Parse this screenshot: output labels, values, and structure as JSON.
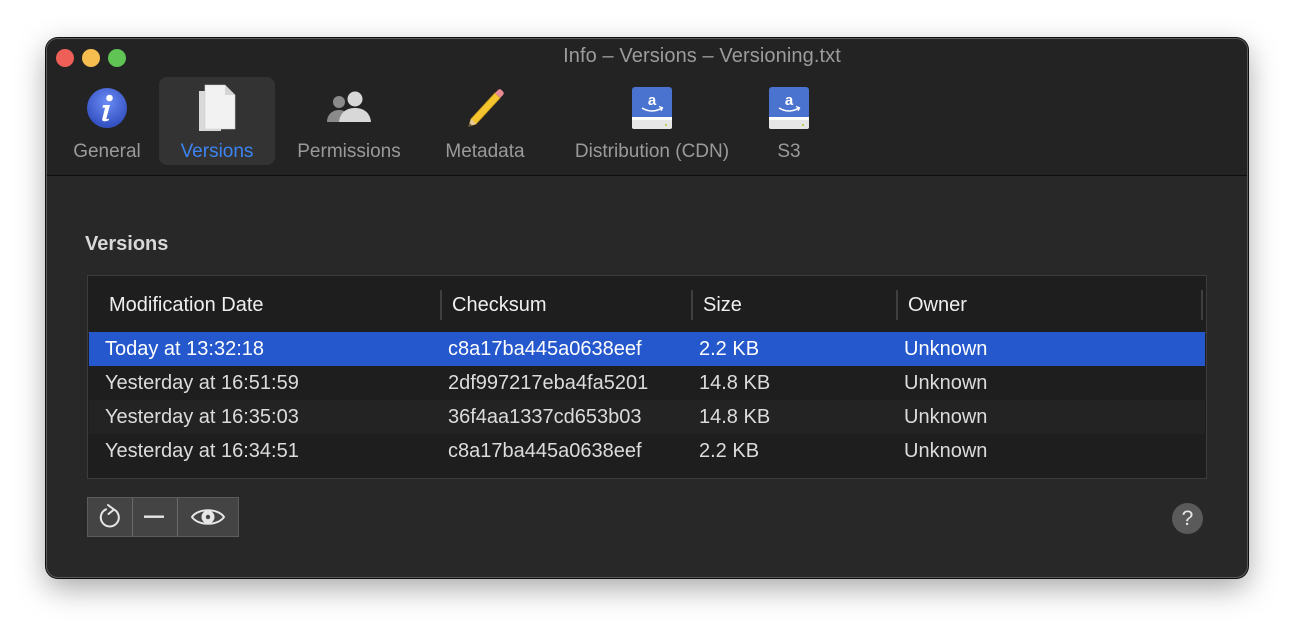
{
  "window": {
    "title": "Info – Versions – Versioning.txt"
  },
  "toolbar": {
    "tabs": [
      {
        "label": "General",
        "icon": "info-icon",
        "active": false
      },
      {
        "label": "Versions",
        "icon": "documents-icon",
        "active": true
      },
      {
        "label": "Permissions",
        "icon": "people-icon",
        "active": false
      },
      {
        "label": "Metadata",
        "icon": "pencil-icon",
        "active": false
      },
      {
        "label": "Distribution (CDN)",
        "icon": "amazon-drive-icon",
        "active": false
      },
      {
        "label": "S3",
        "icon": "amazon-drive-icon",
        "active": false
      }
    ]
  },
  "versions": {
    "section_title": "Versions",
    "columns": [
      "Modification Date",
      "Checksum",
      "Size",
      "Owner"
    ],
    "rows": [
      {
        "date": "Today at 13:32:18",
        "checksum": "c8a17ba445a0638eef",
        "size": "2.2 KB",
        "owner": "Unknown",
        "selected": true
      },
      {
        "date": "Yesterday at 16:51:59",
        "checksum": "2df997217eba4fa5201",
        "size": "14.8 KB",
        "owner": "Unknown",
        "selected": false
      },
      {
        "date": "Yesterday at 16:35:03",
        "checksum": "36f4aa1337cd653b03",
        "size": "14.8 KB",
        "owner": "Unknown",
        "selected": false
      },
      {
        "date": "Yesterday at 16:34:51",
        "checksum": "c8a17ba445a0638eef",
        "size": "2.2 KB",
        "owner": "Unknown",
        "selected": false
      }
    ]
  },
  "actions": {
    "buttons": [
      {
        "name": "revert",
        "icon": "revert-arrow-icon"
      },
      {
        "name": "delete",
        "icon": "minus-icon"
      },
      {
        "name": "quicklook",
        "icon": "eye-icon"
      }
    ],
    "help_label": "?"
  },
  "colors": {
    "accent": "#3d84f2",
    "selection": "#2458cc"
  }
}
